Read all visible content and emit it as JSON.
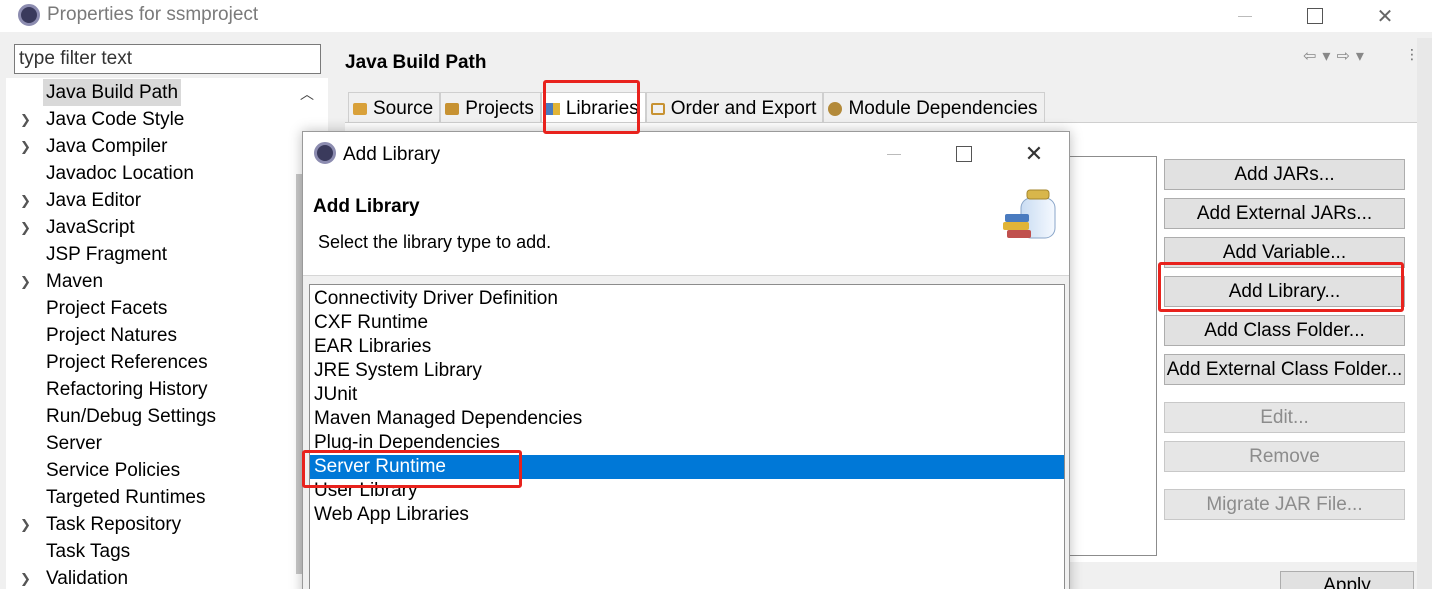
{
  "window": {
    "title": "Properties for ssmproject",
    "icon": "eclipse-icon"
  },
  "filter": {
    "placeholder": "type filter text"
  },
  "tree": {
    "items": [
      {
        "label": "Java Build Path",
        "expandable": false,
        "selected": true
      },
      {
        "label": "Java Code Style",
        "expandable": true
      },
      {
        "label": "Java Compiler",
        "expandable": true
      },
      {
        "label": "Javadoc Location",
        "expandable": false
      },
      {
        "label": "Java Editor",
        "expandable": true
      },
      {
        "label": "JavaScript",
        "expandable": true
      },
      {
        "label": "JSP Fragment",
        "expandable": false
      },
      {
        "label": "Maven",
        "expandable": true
      },
      {
        "label": "Project Facets",
        "expandable": false
      },
      {
        "label": "Project Natures",
        "expandable": false
      },
      {
        "label": "Project References",
        "expandable": false
      },
      {
        "label": "Refactoring History",
        "expandable": false
      },
      {
        "label": "Run/Debug Settings",
        "expandable": false
      },
      {
        "label": "Server",
        "expandable": false
      },
      {
        "label": "Service Policies",
        "expandable": false
      },
      {
        "label": "Targeted Runtimes",
        "expandable": false
      },
      {
        "label": "Task Repository",
        "expandable": true
      },
      {
        "label": "Task Tags",
        "expandable": false
      },
      {
        "label": "Validation",
        "expandable": true
      }
    ]
  },
  "page": {
    "title": "Java Build Path",
    "tabs": [
      {
        "label": "Source",
        "icon": "source-folder-icon"
      },
      {
        "label": "Projects",
        "icon": "projects-icon"
      },
      {
        "label": "Libraries",
        "icon": "libraries-icon",
        "active": true
      },
      {
        "label": "Order and Export",
        "icon": "order-export-icon"
      },
      {
        "label": "Module Dependencies",
        "icon": "module-icon"
      }
    ],
    "buttons": [
      {
        "label": "Add JARs...",
        "enabled": true
      },
      {
        "label": "Add External JARs...",
        "enabled": true
      },
      {
        "label": "Add Variable...",
        "enabled": true
      },
      {
        "label": "Add Library...",
        "enabled": true
      },
      {
        "label": "Add Class Folder...",
        "enabled": true
      },
      {
        "label": "Add External Class Folder...",
        "enabled": true
      },
      {
        "label": "Edit...",
        "enabled": false
      },
      {
        "label": "Remove",
        "enabled": false
      },
      {
        "label": "Migrate JAR File...",
        "enabled": false
      }
    ],
    "apply_label": "Apply"
  },
  "dialog": {
    "title": "Add Library",
    "heading": "Add Library",
    "subtitle": "Select the library type to add.",
    "library_types": [
      "Connectivity Driver Definition",
      "CXF Runtime",
      "EAR Libraries",
      "JRE System Library",
      "JUnit",
      "Maven Managed Dependencies",
      "Plug-in Dependencies",
      "Server Runtime",
      "User Library",
      "Web App Libraries"
    ],
    "selected": "Server Runtime"
  },
  "colors": {
    "selection": "#0078d7",
    "highlight": "#e8221d"
  }
}
